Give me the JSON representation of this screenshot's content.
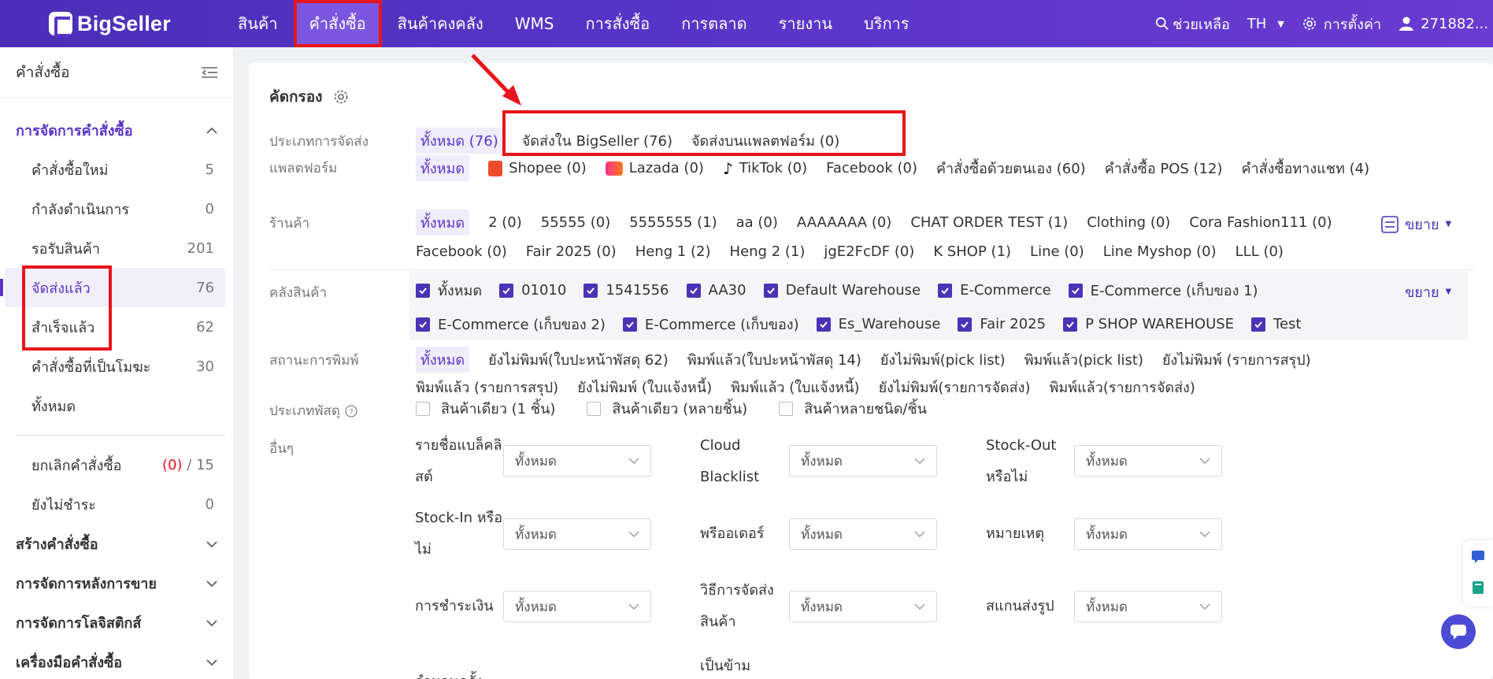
{
  "brand": {
    "name": "BigSeller"
  },
  "topnav": {
    "items": [
      "สินค้า",
      "คำสั่งซื้อ",
      "สินค้าคงคลัง",
      "WMS",
      "การสั่งซื้อ",
      "การตลาด",
      "รายงาน",
      "บริการ"
    ],
    "active_index": 1,
    "help": "ช่วยเหลือ",
    "language": "TH",
    "settings": "การตั้งค่า",
    "user": "271882..."
  },
  "sidebar": {
    "title": "คำสั่งซื้อ",
    "group_order_mgmt": "การจัดการคำสั่งซื้อ",
    "items": [
      {
        "label": "คำสั่งซื้อใหม่",
        "count": "5"
      },
      {
        "label": "กำลังดำเนินการ",
        "count": "0"
      },
      {
        "label": "รอรับสินค้า",
        "count": "201"
      },
      {
        "label": "จัดส่งแล้ว",
        "count": "76"
      },
      {
        "label": "สำเร็จแล้ว",
        "count": "62"
      },
      {
        "label": "คำสั่งซื้อที่เป็นโมฆะ",
        "count": "30"
      },
      {
        "label": "ทั้งหมด",
        "count": ""
      }
    ],
    "cancel": {
      "label": "ยกเลิกคำสั่งซื้อ",
      "count_red": "(0)",
      "slash": "/",
      "count": "15"
    },
    "unpaid": {
      "label": "ยังไม่ชำระ",
      "count": "0"
    },
    "groups": [
      "สร้างคำสั่งซื้อ",
      "การจัดการหลังการขาย",
      "การจัดการโลจิสติกส์",
      "เครื่องมือคำสั่งซื้อ"
    ]
  },
  "filter": {
    "title": "คัดกรอง",
    "shipping_type": {
      "label": "ประเภทการจัดส่ง",
      "options": [
        "ทั้งหมด (76)",
        "จัดส่งใน BigSeller (76)",
        "จัดส่งบนแพลตฟอร์ม (0)"
      ]
    },
    "platform": {
      "label": "แพลตฟอร์ม",
      "options": [
        "ทั้งหมด",
        "Shopee (0)",
        "Lazada (0)",
        "TikTok (0)",
        "Facebook (0)",
        "คำสั่งซื้อด้วยตนเอง (60)",
        "คำสั่งซื้อ POS (12)",
        "คำสั่งซื้อทางแชท (4)"
      ]
    },
    "store": {
      "label": "ร้านค้า",
      "options": [
        "ทั้งหมด",
        "2 (0)",
        "55555 (0)",
        "5555555 (1)",
        "aa (0)",
        "AAAAAAA (0)",
        "CHAT ORDER TEST (1)",
        "Clothing (0)",
        "Cora Fashion111 (0)",
        "Facebook (0)",
        "Fair 2025 (0)",
        "Heng 1 (2)",
        "Heng 2 (1)",
        "jgE2FcDF (0)",
        "K SHOP (1)",
        "Line (0)",
        "Line Myshop (0)",
        "LLL (0)"
      ],
      "expand": "ขยาย"
    },
    "warehouse": {
      "label": "คลังสินค้า",
      "options": [
        "ทั้งหมด",
        "01010",
        "1541556",
        "AA30",
        "Default Warehouse",
        "E-Commerce",
        "E-Commerce (เก็บของ 1)",
        "E-Commerce (เก็บของ 2)",
        "E-Commerce (เก็บของ)",
        "Es_Warehouse",
        "Fair 2025",
        "P SHOP WAREHOUSE",
        "Test"
      ],
      "expand": "ขยาย"
    },
    "print_status": {
      "label": "สถานะการพิมพ์",
      "options": [
        "ทั้งหมด",
        "ยังไม่พิมพ์(ใบปะหน้าพัสดุ 62)",
        "พิมพ์แล้ว(ใบปะหน้าพัสดุ 14)",
        "ยังไม่พิมพ์(pick list)",
        "พิมพ์แล้ว(pick list)",
        "ยังไม่พิมพ์ (รายการสรุป)",
        "พิมพ์แล้ว (รายการสรุป)",
        "ยังไม่พิมพ์ (ใบแจ้งหนี้)",
        "พิมพ์แล้ว (ใบแจ้งหนี้)",
        "ยังไม่พิมพ์(รายการจัดส่ง)",
        "พิมพ์แล้ว(รายการจัดส่ง)"
      ]
    },
    "parcel_type": {
      "label": "ประเภทพัสดุ",
      "options": [
        "สินค้าเดียว (1 ชิ้น)",
        "สินค้าเดียว (หลายชิ้น)",
        "สินค้าหลายชนิด/ชิ้น"
      ]
    },
    "other": {
      "label": "อื่นๆ",
      "select_value": "ทั้งหมด",
      "blacklist_1": "รายชื่อแบล็คลิ",
      "blacklist_2": "สต์",
      "cloud_1": "Cloud",
      "cloud_2": "Blacklist",
      "stockout_1": "Stock-Out",
      "stockout_2": "หรือไม่",
      "stockin_1": "Stock-In หรือ",
      "stockin_2": "ไม่",
      "preorder": "พรีออเดอร์",
      "note": "หมายเหตุ",
      "payment": "การชำระเงิน",
      "ship_method_1": "วิธีการจัดส่ง",
      "ship_method_2": "สินค้า",
      "scan_photo": "สแกนส่งรูป",
      "cross_border": "เป็นข้าม",
      "count_partial": "จำนวนครั้ง"
    }
  },
  "colors": {
    "brand": "#5a35c8",
    "highlight_red": "#e8141b",
    "checkbox": "#4b33b6"
  }
}
